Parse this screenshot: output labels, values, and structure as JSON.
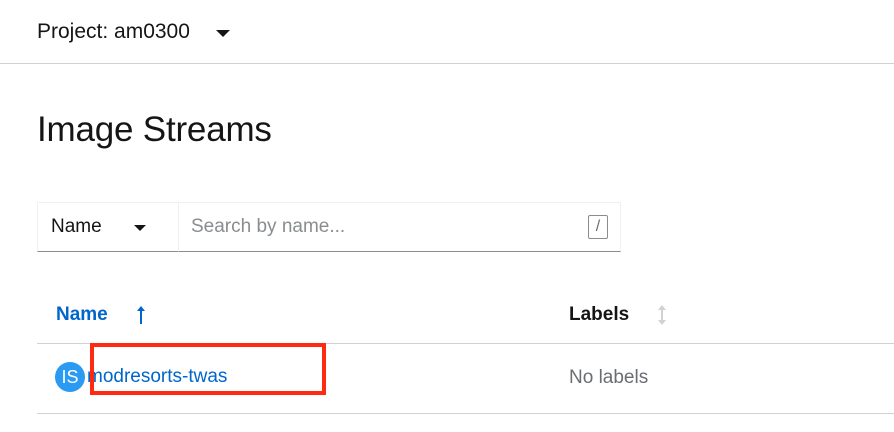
{
  "project_bar": {
    "label": "Project: am0300"
  },
  "page": {
    "title": "Image Streams"
  },
  "filter": {
    "selected": "Name",
    "search_placeholder": "Search by name...",
    "search_value": "",
    "shortcut_hint": "/"
  },
  "table": {
    "columns": [
      {
        "label": "Name",
        "sort": "ascending",
        "sort_icon": "arrow-up-icon"
      },
      {
        "label": "Labels",
        "sort": "none",
        "sort_icon": "sort-icon"
      }
    ],
    "rows": [
      {
        "badge": "IS",
        "name": "modresorts-twas",
        "labels": "No labels"
      }
    ]
  },
  "colors": {
    "link": "#0066cc",
    "badge": "#2b9af3",
    "highlight": "#ff2a12",
    "muted": "#6a6e73"
  }
}
